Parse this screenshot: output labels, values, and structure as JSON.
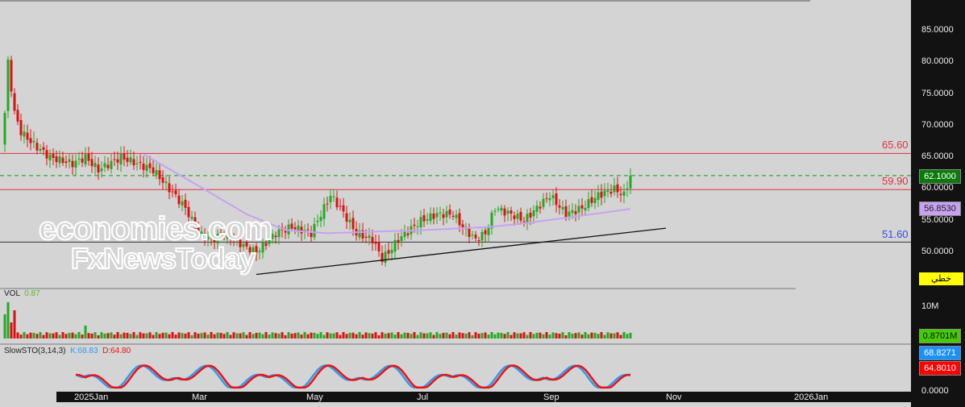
{
  "price_axis": {
    "labels": [
      "85.0000",
      "80.0000",
      "75.0000",
      "70.0000",
      "65.0000",
      "60.0000",
      "55.0000",
      "50.0000"
    ],
    "values": [
      85,
      80,
      75,
      70,
      65,
      60,
      55,
      50
    ]
  },
  "tags": {
    "last": "62.1000",
    "ma": "56.8530",
    "mode": "خطي",
    "volume": "0.8701M",
    "k": "68.8271",
    "d": "64.8010",
    "vol_tick": "10M",
    "sto_zero": "0.0000"
  },
  "levels": [
    {
      "label": "65.60",
      "value": 65.6,
      "color": "#e03040"
    },
    {
      "label": "59.90",
      "value": 59.9,
      "color": "#e03040"
    },
    {
      "label": "51.60",
      "value": 51.6,
      "color": "#3050e0"
    }
  ],
  "volume_panel": {
    "title": "VOL",
    "value": "0.87"
  },
  "sto_panel": {
    "title": "SlowSTO(3,14,3)",
    "k": "K:68.83",
    "d": "D:64.80"
  },
  "time_axis": [
    "2025Jan",
    "Mar",
    "May",
    "Jul",
    "Sep",
    "Nov",
    "2026Jan"
  ],
  "watermark": {
    "line1": "economies.com",
    "line2": "FxNewsToday"
  },
  "colors": {
    "up": "#22aa22",
    "down": "#dd1111",
    "ma": "#c7a2f0",
    "k": "#2a9cf0",
    "d": "#ee1111"
  },
  "chart_data": {
    "type": "candlestick",
    "ylim": [
      45,
      87
    ],
    "last_price": 62.1,
    "waypoints_index": [
      0,
      1,
      3,
      5,
      9,
      14,
      21,
      25,
      29,
      36,
      46,
      51,
      56,
      60,
      64,
      69,
      74,
      78,
      80,
      84,
      89,
      95,
      99,
      101,
      104,
      109,
      114,
      117,
      119,
      122,
      129,
      134,
      139,
      142,
      146,
      149,
      152,
      157,
      161,
      165,
      169,
      174,
      179,
      184,
      189,
      192,
      194
    ],
    "waypoints_close": [
      72,
      80,
      72,
      69,
      67,
      65,
      64,
      65,
      63,
      65,
      63,
      60,
      57,
      53,
      52,
      53,
      51,
      50,
      51,
      53,
      54,
      53,
      57,
      59,
      57,
      53,
      52,
      49,
      50,
      52,
      55,
      56,
      56,
      54,
      52,
      53,
      57,
      56,
      55,
      57,
      59,
      56,
      57,
      59,
      60,
      59,
      62.1
    ],
    "ma_index": [
      43,
      60,
      75,
      87,
      100,
      130,
      150,
      160,
      175,
      194
    ],
    "ma_values": [
      65.5,
      60.5,
      56,
      53.5,
      53,
      53.5,
      54,
      54.5,
      55.5,
      56.85
    ],
    "trendline": [
      {
        "index": 78,
        "value": 46.5
      },
      {
        "index": 205,
        "value": 53.8
      }
    ]
  }
}
